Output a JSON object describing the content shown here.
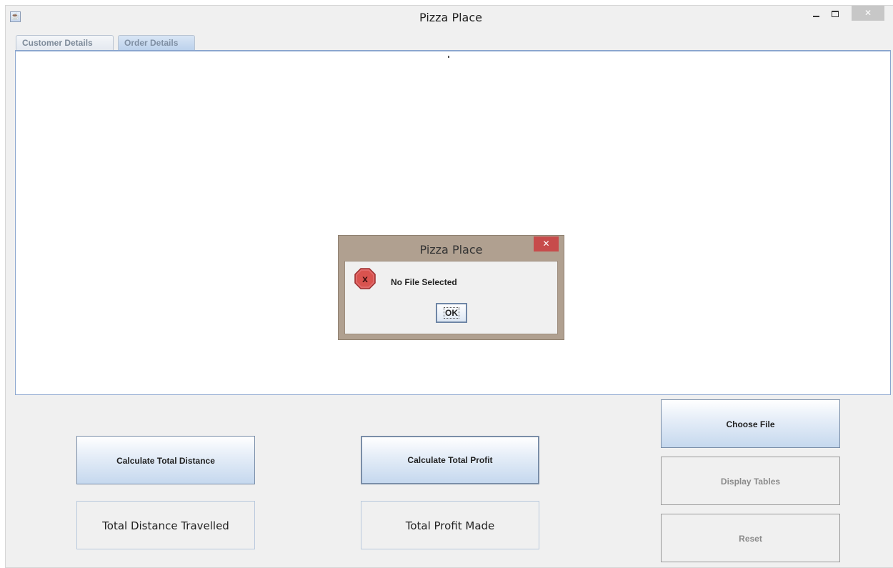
{
  "window": {
    "title": "Pizza Place",
    "close_glyph": "✕"
  },
  "tabs": [
    {
      "label": "Customer Details"
    },
    {
      "label": "Order Details"
    }
  ],
  "buttons": {
    "calc_distance": "Calculate Total Distance",
    "calc_profit": "Calculate Total Profit",
    "choose_file": "Choose File",
    "display_tables": "Display Tables",
    "reset": "Reset"
  },
  "fields": {
    "total_distance": "Total Distance Travelled",
    "total_profit": "Total Profit Made"
  },
  "dialog": {
    "title": "Pizza Place",
    "close_glyph": "✕",
    "message": "No File Selected",
    "ok_label": "OK",
    "icon": "error-icon",
    "icon_glyph": "x"
  },
  "colors": {
    "error_red": "#d9534f",
    "dialog_frame": "#b0a090",
    "button_gradient_bottom": "#c5d8ee"
  }
}
